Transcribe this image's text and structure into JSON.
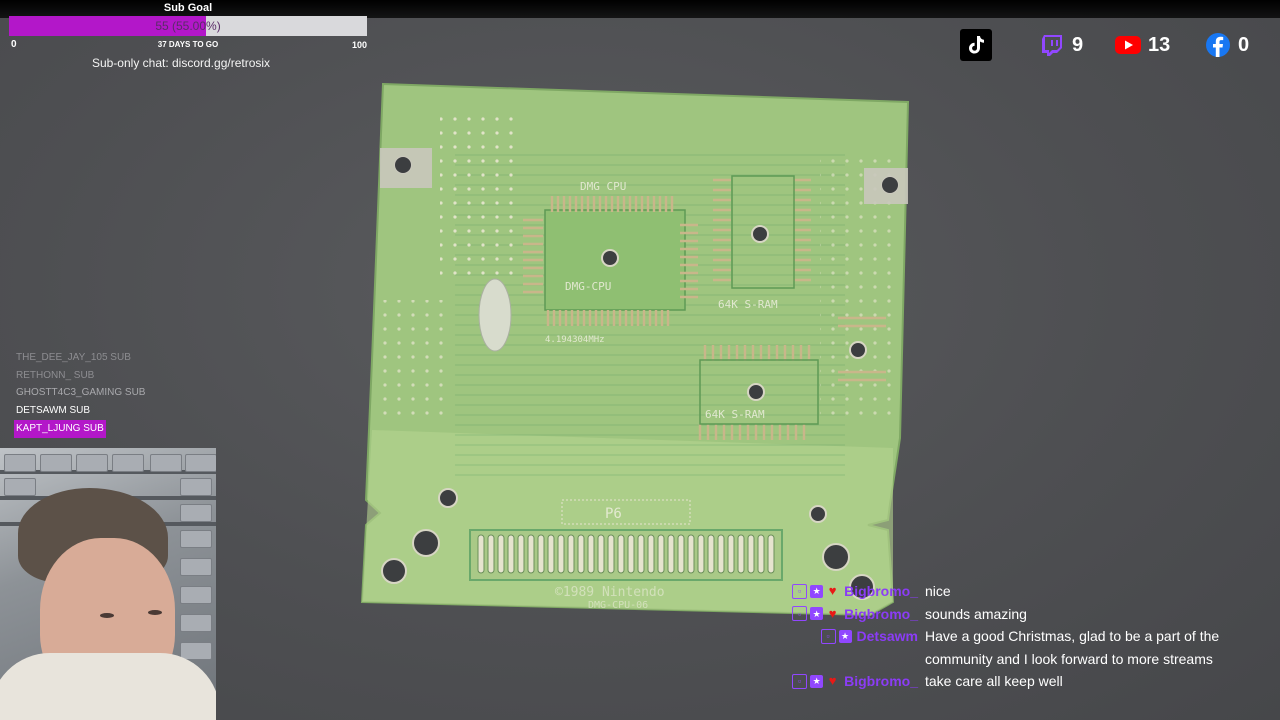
{
  "sub_goal": {
    "title": "Sub Goal",
    "progress_text": "55 (55.00%)",
    "progress_fraction": 0.55,
    "min": "0",
    "days_left": "37 DAYS TO GO",
    "max": "100",
    "fill_color": "#b317c9"
  },
  "discord_text": "Sub-only chat: discord.gg/retrosix",
  "socials": [
    {
      "icon": "tiktok-icon",
      "count": ""
    },
    {
      "icon": "twitch-icon",
      "count": "9",
      "color": "#9147ff"
    },
    {
      "icon": "youtube-icon",
      "count": "13",
      "color": "#ff0000"
    },
    {
      "icon": "facebook-icon",
      "count": "0",
      "color": "#1877f2"
    }
  ],
  "recent_subs": [
    "THE_DEE_JAY_105  SUB",
    "RETHONN_  SUB",
    "GHOSTT4C3_GAMING  SUB",
    "DETSAWM  SUB",
    "KAPT_LJUNG  SUB"
  ],
  "pcb_text": {
    "cpu": "DMG CPU",
    "cpu2": "DMG-CPU",
    "ram1": "64K S-RAM",
    "ram2": "64K S-RAM",
    "brand": "©1989 Nintendo",
    "board": "DMG-CPU-06",
    "p6": "P6",
    "crystal": "4.194304MHz"
  },
  "chat": [
    {
      "user": "Bigbromo_",
      "text": "nice",
      "badges": [
        "sub",
        "vip",
        "heart"
      ]
    },
    {
      "user": "Bigbromo_",
      "text": "sounds amazing",
      "badges": [
        "sub",
        "vip",
        "heart"
      ]
    },
    {
      "user": "Detsawm",
      "text": "Have a good Christmas, glad to be a part of the community and I look forward to more streams",
      "badges": [
        "sub",
        "vip"
      ]
    },
    {
      "user": "Bigbromo_",
      "text": "take care all keep well",
      "badges": [
        "sub",
        "vip",
        "heart"
      ]
    }
  ]
}
